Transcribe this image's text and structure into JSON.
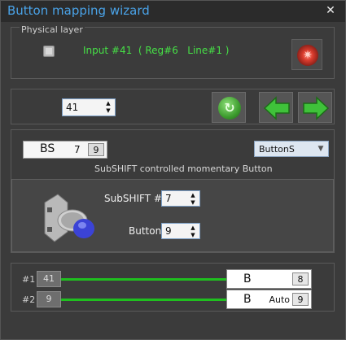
{
  "window": {
    "title": "Button mapping wizard",
    "close_glyph": "✕"
  },
  "physical_layer": {
    "group_label": "Physical layer",
    "input_text": "Input #41  ( Reg#6   Line#1 )",
    "led_icon": "red-led-icon"
  },
  "navigation": {
    "index_value": "41",
    "refresh_icon": "refresh-icon",
    "prev_icon": "arrow-left-icon",
    "next_icon": "arrow-right-icon"
  },
  "mapping": {
    "code": "BS",
    "number": "7",
    "mini_value": "9",
    "type_selected": "ButtonS",
    "description": "SubSHIFT controlled momentary Button",
    "subshift_label": "SubSHIFT #",
    "subshift_value": "7",
    "button_label": "Button",
    "button_value": "9"
  },
  "outputs": [
    {
      "label": "#1",
      "input": "41",
      "code": "B",
      "auto": "",
      "value": "8"
    },
    {
      "label": "#2",
      "input": "9",
      "code": "B",
      "auto": "Auto",
      "value": "9"
    }
  ],
  "colors": {
    "title_blue": "#4aa3e8",
    "status_green": "#46e046",
    "line_green": "#1fbf1f",
    "led_red": "#d83b2d"
  }
}
